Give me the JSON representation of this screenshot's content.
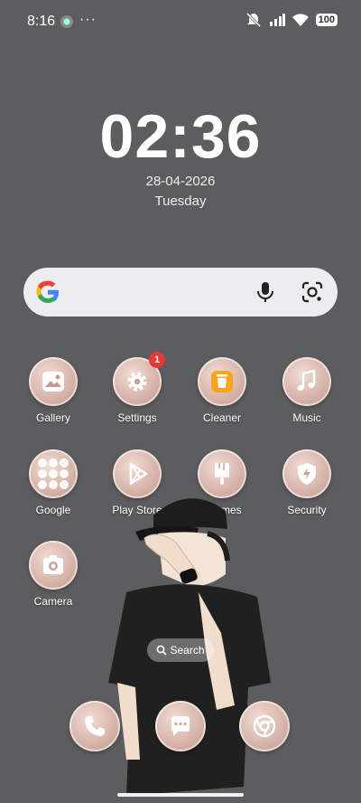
{
  "status_bar": {
    "time": "8:16",
    "more": "···",
    "battery": "100"
  },
  "clock": {
    "time": "02:36",
    "date": "28-04-2026",
    "day": "Tuesday"
  },
  "search_widget": {
    "logo": "google-g",
    "mic_icon": "mic-icon",
    "lens_icon": "lens-icon"
  },
  "apps": [
    {
      "label": "Gallery",
      "icon": "gallery-icon"
    },
    {
      "label": "Settings",
      "icon": "gear-icon",
      "badge": "1"
    },
    {
      "label": "Cleaner",
      "icon": "trash-icon"
    },
    {
      "label": "Music",
      "icon": "music-note-icon"
    },
    {
      "label": "Google",
      "icon": "folder-icon"
    },
    {
      "label": "Play Store",
      "icon": "play-store-icon"
    },
    {
      "label": "Themes",
      "icon": "brush-icon"
    },
    {
      "label": "Security",
      "icon": "shield-icon"
    },
    {
      "label": "Camera",
      "icon": "camera-icon"
    }
  ],
  "home_search": {
    "label": "Search"
  },
  "dock": [
    {
      "name": "Phone",
      "icon": "phone-icon"
    },
    {
      "name": "Messages",
      "icon": "message-icon"
    },
    {
      "name": "Chrome",
      "icon": "chrome-icon"
    }
  ]
}
